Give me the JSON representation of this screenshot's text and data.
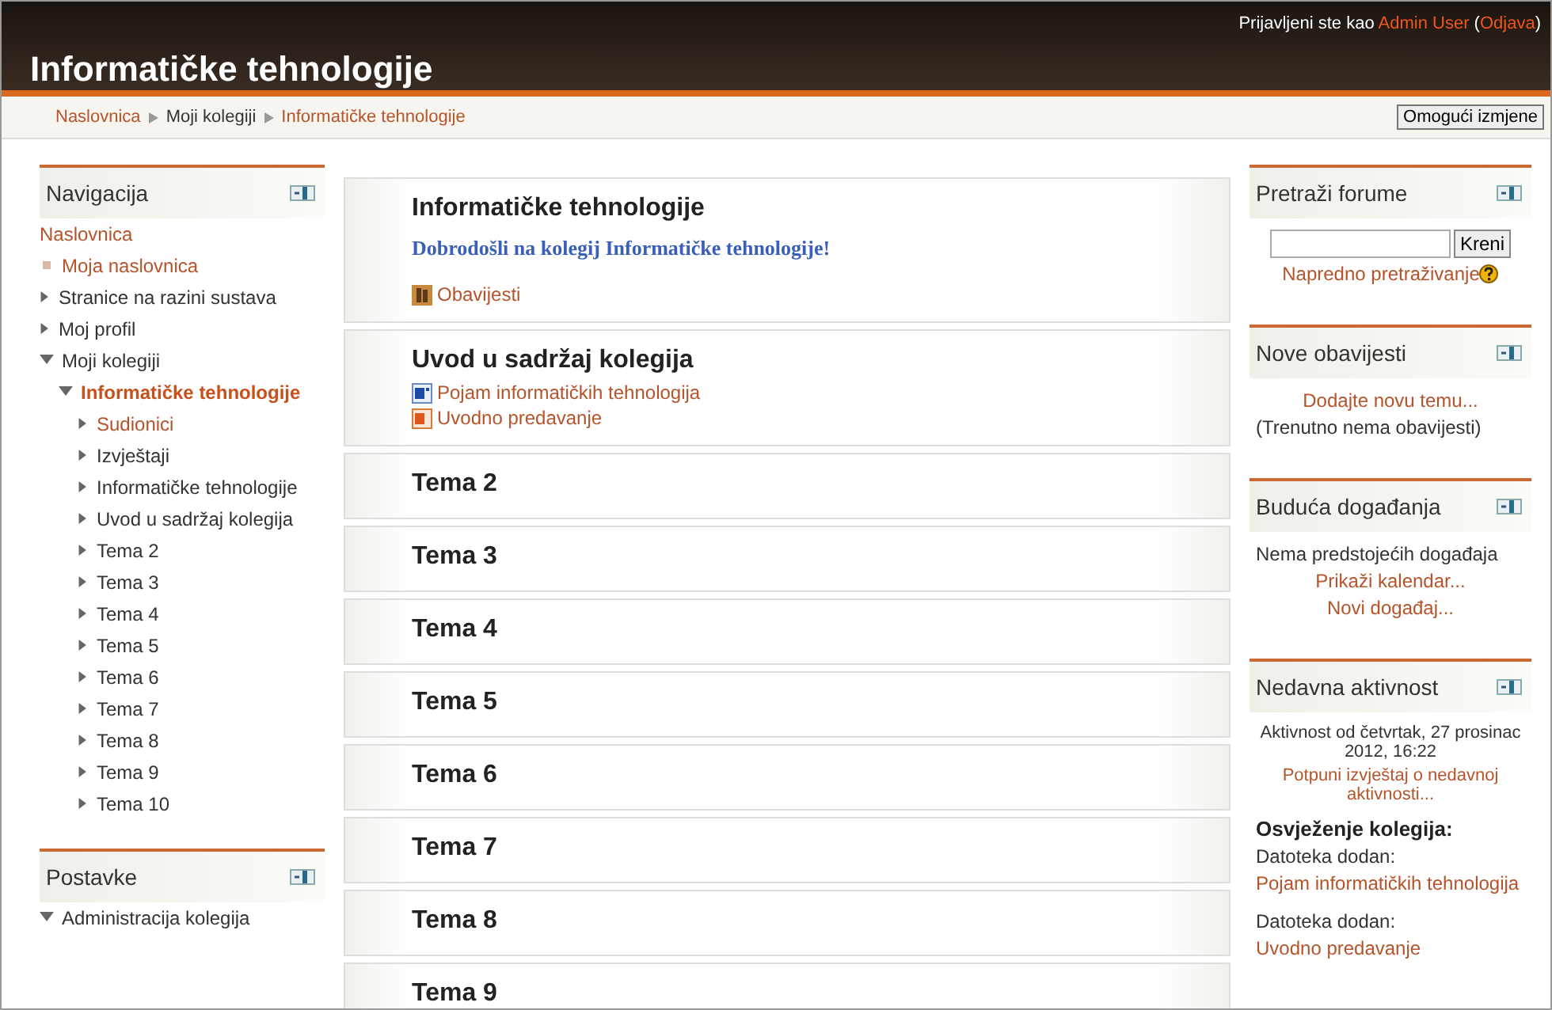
{
  "header": {
    "title": "Informatičke tehnologije",
    "login": {
      "text": "Prijavljeni ste kao",
      "user": "Admin User",
      "open": "(",
      "logout": "Odjava",
      "close": ")"
    }
  },
  "breadcrumb": [
    {
      "label": "Naslovnica",
      "link": true
    },
    {
      "label": "Moji kolegiji",
      "link": false
    },
    {
      "label": "Informatičke tehnologije",
      "link": true
    }
  ],
  "edit_button": "Omogući izmjene",
  "left_blocks": [
    {
      "title": "Navigacija",
      "tree": [
        {
          "label": "Naslovnica",
          "kind": "plain",
          "link": true,
          "current": false
        },
        {
          "label": "Moja naslovnica",
          "kind": "leaf",
          "link": true,
          "current": false
        },
        {
          "label": "Stranice na razini sustava",
          "kind": "branch",
          "expanded": false,
          "link": false,
          "current": false
        },
        {
          "label": "Moj profil",
          "kind": "branch",
          "expanded": false,
          "link": false,
          "current": false
        },
        {
          "label": "Moji kolegiji",
          "kind": "branch",
          "expanded": true,
          "link": false,
          "current": false,
          "children": [
            {
              "label": "Informatičke tehnologije",
              "kind": "branch",
              "expanded": true,
              "link": true,
              "current": true,
              "children": [
                {
                  "label": "Sudionici",
                  "kind": "branch",
                  "expanded": false,
                  "link": true,
                  "current": false
                },
                {
                  "label": "Izvještaji",
                  "kind": "branch",
                  "expanded": false,
                  "link": false,
                  "current": false
                },
                {
                  "label": "Informatičke tehnologije",
                  "kind": "branch",
                  "expanded": false,
                  "link": false,
                  "current": false
                },
                {
                  "label": "Uvod u sadržaj kolegija",
                  "kind": "branch",
                  "expanded": false,
                  "link": false,
                  "current": false
                },
                {
                  "label": "Tema 2",
                  "kind": "branch",
                  "expanded": false,
                  "link": false,
                  "current": false
                },
                {
                  "label": "Tema 3",
                  "kind": "branch",
                  "expanded": false,
                  "link": false,
                  "current": false
                },
                {
                  "label": "Tema 4",
                  "kind": "branch",
                  "expanded": false,
                  "link": false,
                  "current": false
                },
                {
                  "label": "Tema 5",
                  "kind": "branch",
                  "expanded": false,
                  "link": false,
                  "current": false
                },
                {
                  "label": "Tema 6",
                  "kind": "branch",
                  "expanded": false,
                  "link": false,
                  "current": false
                },
                {
                  "label": "Tema 7",
                  "kind": "branch",
                  "expanded": false,
                  "link": false,
                  "current": false
                },
                {
                  "label": "Tema 8",
                  "kind": "branch",
                  "expanded": false,
                  "link": false,
                  "current": false
                },
                {
                  "label": "Tema 9",
                  "kind": "branch",
                  "expanded": false,
                  "link": false,
                  "current": false
                },
                {
                  "label": "Tema 10",
                  "kind": "branch",
                  "expanded": false,
                  "link": false,
                  "current": false
                }
              ]
            }
          ]
        }
      ]
    },
    {
      "title": "Postavke",
      "tree": [
        {
          "label": "Administracija kolegija",
          "kind": "branch",
          "expanded": true,
          "link": false,
          "current": false
        }
      ]
    }
  ],
  "sections": [
    {
      "title": "Informatičke tehnologije",
      "summary": "Dobrodošli na kolegij Informatičke tehnologije!",
      "activities": [
        {
          "kind": "forum",
          "label": "Obavijesti"
        }
      ]
    },
    {
      "title": "Uvod u sadržaj kolegija",
      "activities": [
        {
          "kind": "word",
          "label": "Pojam informatičkih tehnologija"
        },
        {
          "kind": "powerpoint",
          "label": "Uvodno predavanje"
        }
      ]
    },
    {
      "title": "Tema 2"
    },
    {
      "title": "Tema 3"
    },
    {
      "title": "Tema 4"
    },
    {
      "title": "Tema 5"
    },
    {
      "title": "Tema 6"
    },
    {
      "title": "Tema 7"
    },
    {
      "title": "Tema 8"
    },
    {
      "title": "Tema 9"
    }
  ],
  "right_blocks": [
    {
      "title": "Pretraži forume",
      "items": [
        {
          "kind": "search",
          "button": "Kreni"
        },
        {
          "kind": "action",
          "text": "Napredno pretraživanje",
          "help": true
        }
      ]
    },
    {
      "title": "Nove obavijesti",
      "items": [
        {
          "kind": "action",
          "text": "Dodajte novu temu..."
        },
        {
          "kind": "text",
          "text": "(Trenutno nema obavijesti)"
        }
      ]
    },
    {
      "title": "Buduća događanja",
      "items": [
        {
          "kind": "text",
          "text": "Nema predstojećih događaja"
        },
        {
          "kind": "action",
          "text": "Prikaži kalendar..."
        },
        {
          "kind": "action",
          "text": "Novi događaj..."
        }
      ]
    },
    {
      "title": "Nedavna aktivnost",
      "items": [
        {
          "kind": "small",
          "text": "Aktivnost od četvrtak, 27 prosinac 2012, 16:22"
        },
        {
          "kind": "smalllink",
          "text": "Potpuni izvještaj o nedavnoj aktivnosti..."
        },
        {
          "kind": "heading",
          "text": "Osvježenje kolegija:"
        },
        {
          "kind": "text",
          "text": "Datoteka dodan:"
        },
        {
          "kind": "link",
          "text": "Pojam informatičkih tehnologija"
        },
        {
          "kind": "text",
          "text": "Datoteka dodan:",
          "gap": true
        },
        {
          "kind": "link",
          "text": "Uvodno predavanje"
        }
      ]
    }
  ]
}
